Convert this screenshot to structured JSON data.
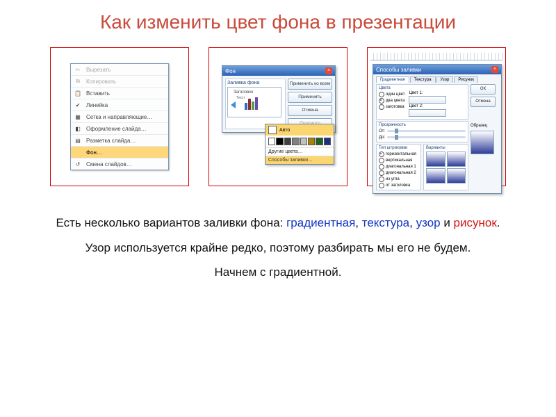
{
  "title": "Как изменить цвет фона в презентации",
  "ctx_menu": {
    "items": [
      {
        "label": "Вырезать",
        "icon": "✂",
        "dim": true
      },
      {
        "label": "Копировать",
        "icon": "⧉",
        "dim": true
      },
      {
        "label": "Вставить",
        "icon": "📋",
        "dim": false
      },
      {
        "label": "Линейка",
        "icon": "✔",
        "dim": false
      },
      {
        "label": "Сетка и направляющие…",
        "icon": "▦",
        "dim": false
      },
      {
        "label": "Оформление слайда…",
        "icon": "◧",
        "dim": false
      },
      {
        "label": "Разметка слайда…",
        "icon": "▤",
        "dim": false
      },
      {
        "label": "Фон…",
        "icon": "",
        "dim": false,
        "selected": true
      },
      {
        "label": "Смена слайдов…",
        "icon": "↺",
        "dim": false
      }
    ]
  },
  "bg_dialog": {
    "title": "Фон",
    "fill_label": "Заливка фона",
    "preview_title": "Заголовок",
    "preview_text": "Текст",
    "buttons": {
      "apply_all": "Применить ко всем",
      "apply": "Применить",
      "cancel": "Отмена",
      "preview": "Просмотр"
    }
  },
  "color_dropdown": {
    "auto": "Авто",
    "swatches": [
      "#ffffff",
      "#000000",
      "#404040",
      "#808080",
      "#c0c0c0",
      "#b08000",
      "#206020",
      "#203080"
    ],
    "more": "Другие цвета…",
    "fill": "Способы заливки…"
  },
  "fx_dialog": {
    "title": "Способы заливки",
    "tabs": [
      "Градиентная",
      "Текстура",
      "Узор",
      "Рисунок"
    ],
    "colors_label": "Цвета",
    "color_opts": [
      "один цвет",
      "два цвета",
      "заготовка"
    ],
    "c1": "Цвет 1:",
    "c2": "Цвет 2:",
    "transp_label": "Прозрачность",
    "from": "От:",
    "to": "До:",
    "shading_label": "Тип штриховки",
    "shading_opts": [
      "горизонтальная",
      "вертикальная",
      "диагональная 1",
      "диагональная 2",
      "из угла",
      "от заголовка"
    ],
    "variants_label": "Варианты",
    "sample_label": "Образец",
    "ok": "ОК",
    "cancel": "Отмена"
  },
  "body": {
    "p1_a": "Есть несколько вариантов заливки фона: ",
    "p1_grad": "градиентная",
    "p1_sep1": ", ",
    "p1_tex": "текстура",
    "p1_sep2": ", ",
    "p1_pat": "узор",
    "p1_and": " и ",
    "p1_pic": "рисунок",
    "p1_dot": ".",
    "p2": "Узор используется крайне редко, поэтому разбирать мы его не будем.",
    "p3": "Начнем с градиентной."
  }
}
